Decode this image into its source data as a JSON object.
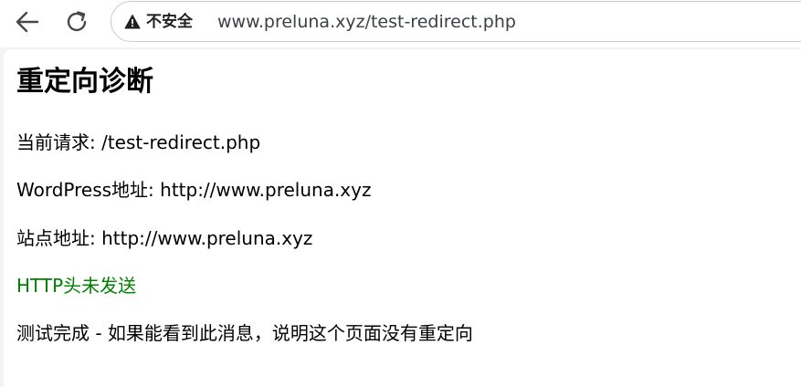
{
  "browser": {
    "back_icon": "arrow-left-icon",
    "reload_icon": "reload-icon",
    "security_icon": "warning-triangle-icon",
    "security_label": "不安全",
    "url": "www.preluna.xyz/test-redirect.php"
  },
  "page": {
    "title": "重定向诊断",
    "lines": [
      "当前请求: /test-redirect.php",
      "WordPress地址: http://www.preluna.xyz",
      "站点地址: http://www.preluna.xyz",
      "HTTP头未发送",
      "测试完成 - 如果能看到此消息，说明这个页面没有重定向"
    ],
    "status_color": "#008000"
  }
}
